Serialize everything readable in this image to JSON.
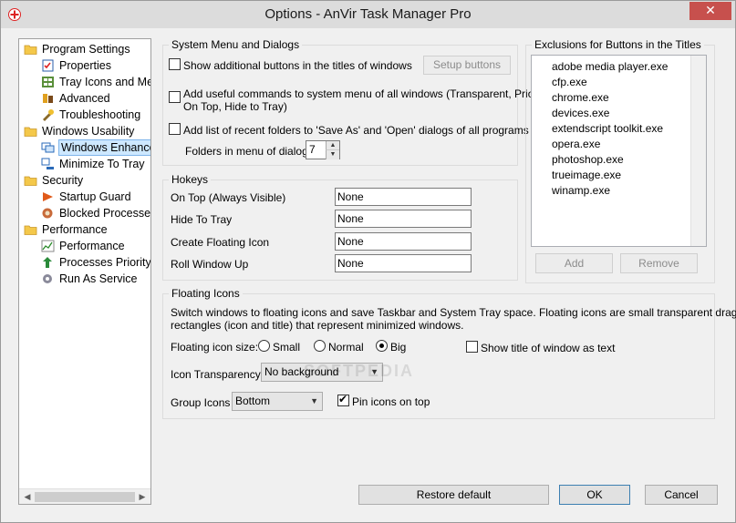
{
  "window": {
    "title": "Options - AnVir Task Manager Pro",
    "close_glyph": "✕"
  },
  "tree": {
    "items": [
      {
        "label": "Program Settings",
        "icon": "folder-icon",
        "level": 0
      },
      {
        "label": "Properties",
        "icon": "properties-icon",
        "level": 1
      },
      {
        "label": "Tray Icons and Menu",
        "icon": "tray-icons-icon",
        "level": 1
      },
      {
        "label": "Advanced",
        "icon": "advanced-icon",
        "level": 1
      },
      {
        "label": "Troubleshooting",
        "icon": "troubleshooting-icon",
        "level": 1
      },
      {
        "label": "Windows Usability",
        "icon": "folder-icon",
        "level": 0
      },
      {
        "label": "Windows Enhancements",
        "icon": "windows-enhancements-icon",
        "level": 1,
        "selected": true
      },
      {
        "label": "Minimize To Tray",
        "icon": "minimize-tray-icon",
        "level": 1
      },
      {
        "label": "Security",
        "icon": "folder-icon",
        "level": 0
      },
      {
        "label": "Startup Guard",
        "icon": "startup-guard-icon",
        "level": 1
      },
      {
        "label": "Blocked Processes",
        "icon": "blocked-processes-icon",
        "level": 1
      },
      {
        "label": "Performance",
        "icon": "folder-icon",
        "level": 0
      },
      {
        "label": "Performance",
        "icon": "performance-icon",
        "level": 1
      },
      {
        "label": "Processes Priority",
        "icon": "processes-priority-icon",
        "level": 1
      },
      {
        "label": "Run As Service",
        "icon": "service-gear-icon",
        "level": 1
      }
    ]
  },
  "system_menu": {
    "title": "System Menu and Dialogs",
    "show_buttons_label": "Show additional buttons in the titles of windows",
    "setup_buttons_label": "Setup buttons",
    "useful_commands_label_1": "Add useful commands to system menu of all windows (Transparent, Priority,",
    "useful_commands_label_2": "On Top, Hide to Tray)",
    "recent_folders_label": "Add list of recent folders to 'Save As' and 'Open' dialogs of all programs",
    "folders_in_menu_label": "Folders in menu of dialogs:",
    "folders_in_menu_value": "7"
  },
  "hotkeys": {
    "title": "Hokeys",
    "rows": [
      {
        "label": "On Top (Always Visible)",
        "value": "None"
      },
      {
        "label": "Hide To Tray",
        "value": "None"
      },
      {
        "label": "Create Floating Icon",
        "value": "None"
      },
      {
        "label": "Roll Window Up",
        "value": "None"
      }
    ]
  },
  "exclusions": {
    "title": "Exclusions for Buttons in the Titles",
    "items": [
      "adobe media player.exe",
      "cfp.exe",
      "chrome.exe",
      "devices.exe",
      "extendscript toolkit.exe",
      "opera.exe",
      "photoshop.exe",
      "trueimage.exe",
      "winamp.exe"
    ],
    "add_label": "Add",
    "remove_label": "Remove"
  },
  "floating": {
    "title": "Floating Icons",
    "desc_1": "Switch windows to floating icons and save Taskbar and System Tray space. Floating icons are small transparent draggable",
    "desc_2": "rectangles (icon and title) that represent minimized windows.",
    "size_label": "Floating icon size:",
    "size_small": "Small",
    "size_normal": "Normal",
    "size_big": "Big",
    "size_selected": "Big",
    "show_title_label": "Show title of window as text",
    "transparency_label": "Icon Transparency",
    "transparency_value": "No background",
    "group_label": "Group Icons",
    "group_value": "Bottom",
    "pin_label": "Pin icons on top"
  },
  "footer": {
    "restore_label": "Restore default",
    "ok_label": "OK",
    "cancel_label": "Cancel"
  },
  "watermark": "SOFTPEDIA"
}
